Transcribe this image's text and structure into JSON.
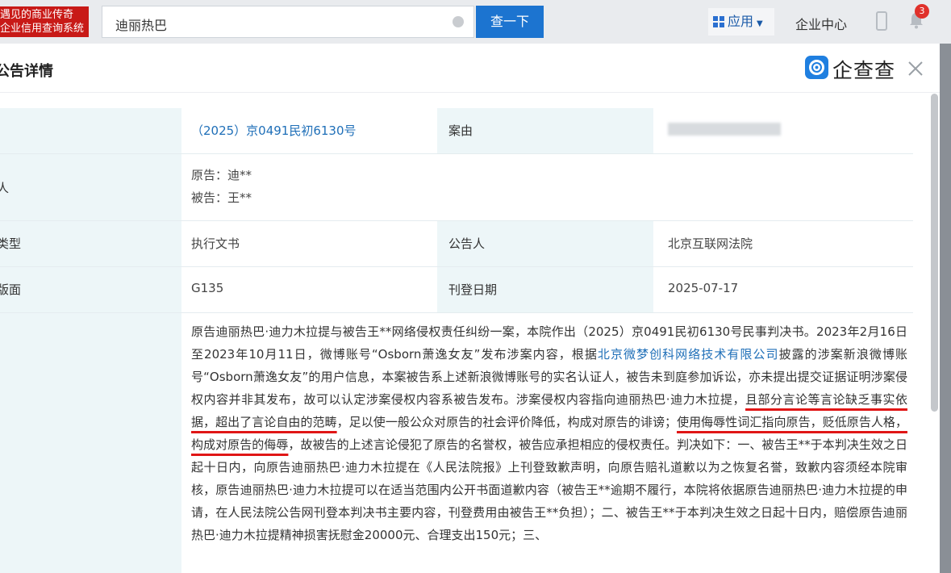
{
  "topbar": {
    "logo_line1": "遇见的商业传奇",
    "logo_line2": "企业信用查询系统",
    "search_value": "迪丽热巴",
    "search_button": "查一下",
    "apps_label": "应用",
    "enterprise_center": "企业中心",
    "notification_count": "3"
  },
  "modal": {
    "title": "公告详情",
    "brand": "企查查"
  },
  "rows": {
    "case_no_value": "（2025）京0491民初6130号",
    "cause_label": "案由",
    "party_label": "人",
    "plaintiff": "原告：迪**",
    "defendant": "被告：王**",
    "type_label": "类型",
    "type_value": "执行文书",
    "announcer_label": "公告人",
    "announcer_value": "北京互联网法院",
    "page_label": "版面",
    "page_value": "G135",
    "date_label": "刊登日期",
    "date_value": "2025-07-17"
  },
  "content": {
    "p1": "原告迪丽热巴·迪力木拉提与被告王**网络侵权责任纠纷一案，本院作出（2025）京0491民初6130号民事判决书。2023年2月16日至2023年10月11日，微博账号“Osborn萧逸女友”发布涉案内容，根据",
    "link": "北京微梦创科网络技术有限公司",
    "p2": "披露的涉案新浪微博账号“Osborn萧逸女友”的用户信息，本案被告系上述新浪微博账号的实名认证人，被告未到庭参加诉讼，亦未提出提交证据证明涉案侵权内容并非其发布，故可以认定涉案侵权内容系被告发布。涉案侵权内容指向迪丽热巴·迪力木拉提，",
    "u1": "且部分言论等言论缺乏事实依据，超出了言论自由的范畴",
    "p3": "，足以使一般公众对原告的社会评价降低，构成对原告的诽谤；",
    "u2": "使用侮辱性词汇指向原告，贬低原告人格，构成对原告的侮辱",
    "p4": "，故被告的上述言论侵犯了原告的名誉权，被告应承担相应的侵权责任。判决如下：一、被告王**于本判决生效之日起十日内，向原告迪丽热巴·迪力木拉提在《人民法院报》上刊登致歉声明，向原告赔礼道歉以为之恢复名誉，致歉内容须经本院审核，原告迪丽热巴·迪力木拉提可以在适当范围内公开书面道歉内容（被告王**逾期不履行，本院将依据原告迪丽热巴·迪力木拉提的申请，在人民法院公告网刊登本判决书主要内容，刊登费用由被告王**负担）；二、被告王**于本判决生效之日起十日内，赔偿原告迪丽热巴·迪力木拉提精神损害抚慰金20000元、合理支出150元；三、"
  },
  "colors": {
    "accent": "#1c74d0",
    "label_bg": "#edf6f8",
    "underline": "#e01616",
    "link": "#1f6fb8"
  }
}
